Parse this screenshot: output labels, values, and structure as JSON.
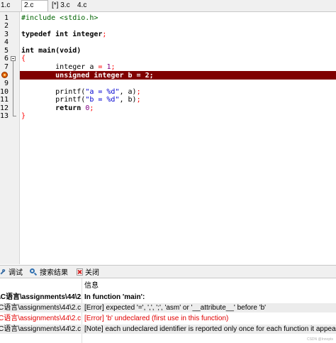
{
  "tabs": [
    "1.c",
    "2.c",
    "[*] 3.c",
    "4.c"
  ],
  "active_tab_index": 1,
  "editor": {
    "line_numbers": [
      "1",
      "2",
      "3",
      "4",
      "5",
      "6",
      "7",
      "8",
      "9",
      "10",
      "11",
      "12",
      "13"
    ],
    "error_line": "8",
    "lines": [
      [
        {
          "t": "#include <stdio.h>",
          "c": "pp"
        }
      ],
      [],
      [
        {
          "t": "typedef int integer",
          "c": "kw"
        },
        {
          "t": ";",
          "c": "op"
        }
      ],
      [],
      [
        {
          "t": "int main(void)",
          "c": "kw"
        }
      ],
      [
        {
          "t": "{",
          "c": "op"
        }
      ],
      [
        {
          "t": "        integer a ",
          "c": ""
        },
        {
          "t": "=",
          "c": "op"
        },
        {
          "t": " ",
          "c": ""
        },
        {
          "t": "1",
          "c": "num"
        },
        {
          "t": ";",
          "c": "op"
        }
      ],
      [
        {
          "t": "        unsigned integer b = 2;",
          "c": ""
        }
      ],
      [],
      [
        {
          "t": "        printf(",
          "c": ""
        },
        {
          "t": "\"a = %d\"",
          "c": "str"
        },
        {
          "t": ", a)",
          "c": ""
        },
        {
          "t": ";",
          "c": "op"
        }
      ],
      [
        {
          "t": "        printf(",
          "c": ""
        },
        {
          "t": "\"b = %d\"",
          "c": "str"
        },
        {
          "t": ", b)",
          "c": ""
        },
        {
          "t": ";",
          "c": "op"
        }
      ],
      [
        {
          "t": "        return ",
          "c": "kw"
        },
        {
          "t": "0",
          "c": "num"
        },
        {
          "t": ";",
          "c": "op"
        }
      ],
      [
        {
          "t": "}",
          "c": "op"
        }
      ]
    ]
  },
  "bottom_tabs": [
    {
      "label": "调试",
      "icon": "debug-icon"
    },
    {
      "label": "搜索结果",
      "icon": "search-icon"
    },
    {
      "label": "关闭",
      "icon": "close-icon"
    }
  ],
  "compile_log": {
    "header": "信息",
    "rows": [
      {
        "file": "\\C语言\\assignments\\44\\2.c",
        "msg": "In function 'main':",
        "style": "bold"
      },
      {
        "file": "C语言\\assignments\\44\\2.c",
        "msg": "[Error] expected '=', ',', ';', 'asm' or '__attribute__' before 'b'",
        "style": ""
      },
      {
        "file": "C语言\\assignments\\44\\2.c",
        "msg": "[Error] 'b' undeclared (first use in this function)",
        "style": "red"
      },
      {
        "file": "C语言\\assignments\\44\\2.c",
        "msg": "[Note] each undeclared identifier is reported only once for each function it appears in",
        "style": ""
      }
    ]
  },
  "watermark": "CSDN @Innopts"
}
